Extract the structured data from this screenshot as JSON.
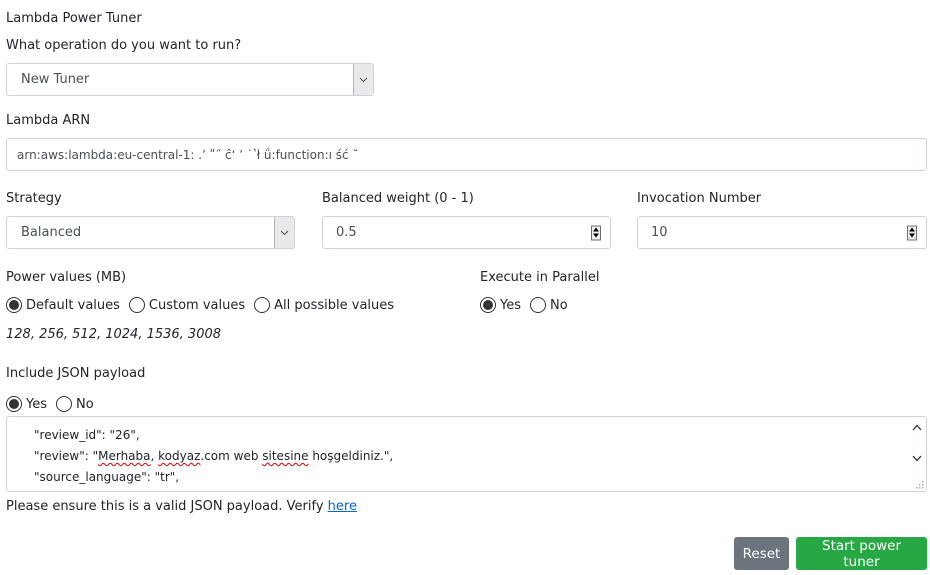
{
  "app": {
    "title": "Lambda Power Tuner"
  },
  "operation": {
    "label": "What operation do you want to run?",
    "selected": "New Tuner"
  },
  "arn": {
    "label": "Lambda ARN",
    "value": "arn:aws:lambda:eu-central-1: .’ ʺ˝ ĉʻ ’ ˙ʽł ǘ:function:ı ść ˘"
  },
  "strategy": {
    "label": "Strategy",
    "selected": "Balanced"
  },
  "balanced_weight": {
    "label": "Balanced weight (0 - 1)",
    "value": "0.5"
  },
  "invocation_number": {
    "label": "Invocation Number",
    "value": "10"
  },
  "power_values": {
    "label": "Power values (MB)",
    "options": [
      {
        "label": "Default values",
        "checked": true
      },
      {
        "label": "Custom values",
        "checked": false
      },
      {
        "label": "All possible values",
        "checked": false
      }
    ],
    "values_text": "128, 256, 512, 1024, 1536, 3008"
  },
  "parallel": {
    "label": "Execute in Parallel",
    "options": [
      {
        "label": "Yes",
        "checked": true
      },
      {
        "label": "No",
        "checked": false
      }
    ]
  },
  "payload": {
    "label": "Include JSON payload",
    "options": [
      {
        "label": "Yes",
        "checked": true
      },
      {
        "label": "No",
        "checked": false
      }
    ],
    "lines": {
      "l1": "\"review_id\": \"26\",",
      "l2_pre": "\"review\": \"",
      "l2_w1": "Merhaba",
      "l2_mid1": ", ",
      "l2_w2": "kodyaz",
      "l2_mid2": ".com web ",
      "l2_w3": "sitesine",
      "l2_post": " hoşgeldiniz.\",",
      "l3": "\"source_language\": \"tr\","
    },
    "hint": "Please ensure this is a valid JSON payload. Verify",
    "verify_link": "here"
  },
  "actions": {
    "reset_label": "Reset",
    "start_label": "Start power tuner",
    "reset_color": "#6c757d",
    "start_color": "#28a745"
  }
}
